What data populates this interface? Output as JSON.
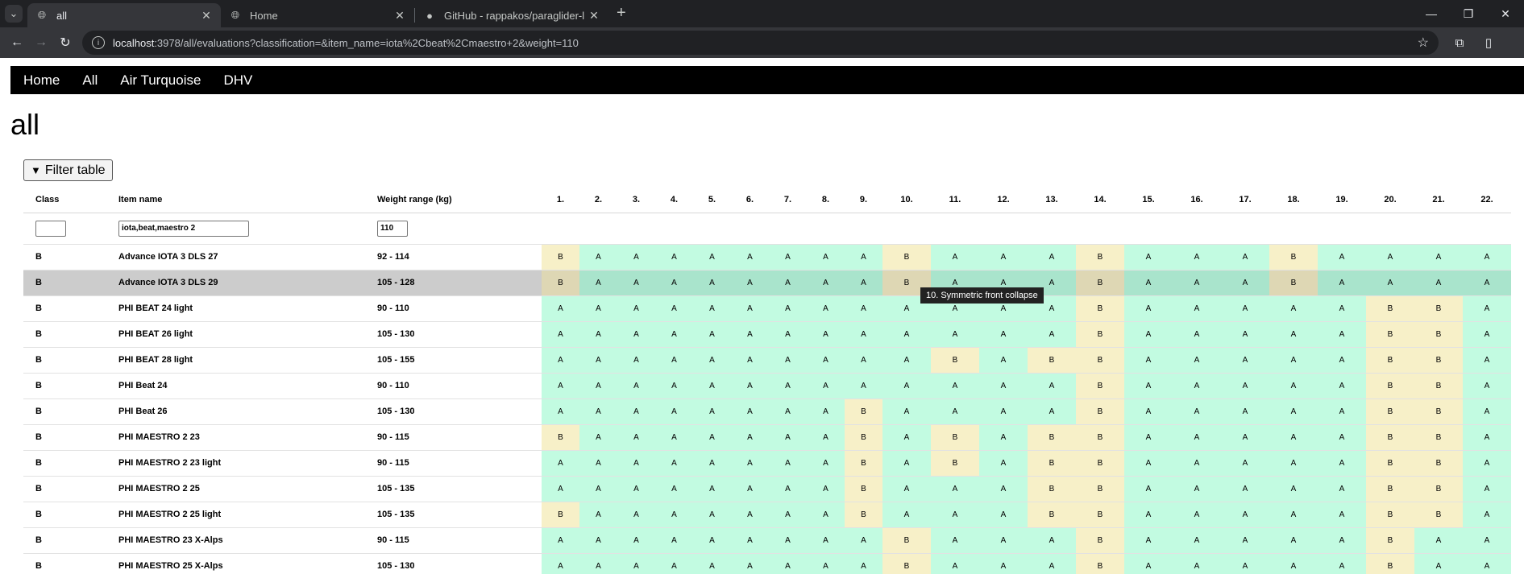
{
  "browser": {
    "tabs": [
      {
        "title": "all",
        "active": true
      },
      {
        "title": "Home",
        "active": false
      },
      {
        "title": "GitHub - rappakos/paraglider-l",
        "active": false
      }
    ],
    "url_host": "localhost",
    "url_rest": ":3978/all/evaluations?classification=&item_name=iota%2Cbeat%2Cmaestro+2&weight=110"
  },
  "nav": {
    "items": [
      "Home",
      "All",
      "Air Turquoise",
      "DHV"
    ]
  },
  "page_title": "all",
  "filter_button": "Filter table",
  "table": {
    "headers": {
      "class": "Class",
      "item_name": "Item name",
      "weight": "Weight range (kg)",
      "tests": [
        "1.",
        "2.",
        "3.",
        "4.",
        "5.",
        "6.",
        "7.",
        "8.",
        "9.",
        "10.",
        "11.",
        "12.",
        "13.",
        "14.",
        "15.",
        "16.",
        "17.",
        "18.",
        "19.",
        "20.",
        "21.",
        "22."
      ]
    },
    "filters": {
      "class": "",
      "item_name": "iota,beat,maestro 2",
      "weight": "110"
    },
    "rows": [
      {
        "class": "B",
        "name": "Advance IOTA 3 DLS 27",
        "weight": "92 - 114",
        "r": [
          "B",
          "A",
          "A",
          "A",
          "A",
          "A",
          "A",
          "A",
          "A",
          "B",
          "A",
          "A",
          "A",
          "B",
          "A",
          "A",
          "A",
          "B",
          "A",
          "A",
          "A",
          "A"
        ]
      },
      {
        "class": "B",
        "name": "Advance IOTA 3 DLS 29",
        "weight": "105 - 128",
        "r": [
          "B",
          "A",
          "A",
          "A",
          "A",
          "A",
          "A",
          "A",
          "A",
          "B",
          "A",
          "A",
          "A",
          "B",
          "A",
          "A",
          "A",
          "B",
          "A",
          "A",
          "A",
          "A"
        ],
        "hover": true
      },
      {
        "class": "B",
        "name": "PHI BEAT 24 light",
        "weight": "90 - 110",
        "r": [
          "A",
          "A",
          "A",
          "A",
          "A",
          "A",
          "A",
          "A",
          "A",
          "A",
          "A",
          "A",
          "A",
          "B",
          "A",
          "A",
          "A",
          "A",
          "A",
          "B",
          "B",
          "A"
        ]
      },
      {
        "class": "B",
        "name": "PHI BEAT 26 light",
        "weight": "105 - 130",
        "r": [
          "A",
          "A",
          "A",
          "A",
          "A",
          "A",
          "A",
          "A",
          "A",
          "A",
          "A",
          "A",
          "A",
          "B",
          "A",
          "A",
          "A",
          "A",
          "A",
          "B",
          "B",
          "A"
        ]
      },
      {
        "class": "B",
        "name": "PHI BEAT 28 light",
        "weight": "105 - 155",
        "r": [
          "A",
          "A",
          "A",
          "A",
          "A",
          "A",
          "A",
          "A",
          "A",
          "A",
          "B",
          "A",
          "B",
          "B",
          "A",
          "A",
          "A",
          "A",
          "A",
          "B",
          "B",
          "A"
        ]
      },
      {
        "class": "B",
        "name": "PHI Beat 24",
        "weight": "90 - 110",
        "r": [
          "A",
          "A",
          "A",
          "A",
          "A",
          "A",
          "A",
          "A",
          "A",
          "A",
          "A",
          "A",
          "A",
          "B",
          "A",
          "A",
          "A",
          "A",
          "A",
          "B",
          "B",
          "A"
        ]
      },
      {
        "class": "B",
        "name": "PHI Beat 26",
        "weight": "105 - 130",
        "r": [
          "A",
          "A",
          "A",
          "A",
          "A",
          "A",
          "A",
          "A",
          "B",
          "A",
          "A",
          "A",
          "A",
          "B",
          "A",
          "A",
          "A",
          "A",
          "A",
          "B",
          "B",
          "A"
        ]
      },
      {
        "class": "B",
        "name": "PHI MAESTRO 2 23",
        "weight": "90 - 115",
        "r": [
          "B",
          "A",
          "A",
          "A",
          "A",
          "A",
          "A",
          "A",
          "B",
          "A",
          "B",
          "A",
          "B",
          "B",
          "A",
          "A",
          "A",
          "A",
          "A",
          "B",
          "B",
          "A"
        ]
      },
      {
        "class": "B",
        "name": "PHI MAESTRO 2 23 light",
        "weight": "90 - 115",
        "r": [
          "A",
          "A",
          "A",
          "A",
          "A",
          "A",
          "A",
          "A",
          "B",
          "A",
          "B",
          "A",
          "B",
          "B",
          "A",
          "A",
          "A",
          "A",
          "A",
          "B",
          "B",
          "A"
        ]
      },
      {
        "class": "B",
        "name": "PHI MAESTRO 2 25",
        "weight": "105 - 135",
        "r": [
          "A",
          "A",
          "A",
          "A",
          "A",
          "A",
          "A",
          "A",
          "B",
          "A",
          "A",
          "A",
          "B",
          "B",
          "A",
          "A",
          "A",
          "A",
          "A",
          "B",
          "B",
          "A"
        ]
      },
      {
        "class": "B",
        "name": "PHI MAESTRO 2 25 light",
        "weight": "105 - 135",
        "r": [
          "B",
          "A",
          "A",
          "A",
          "A",
          "A",
          "A",
          "A",
          "B",
          "A",
          "A",
          "A",
          "B",
          "B",
          "A",
          "A",
          "A",
          "A",
          "A",
          "B",
          "B",
          "A"
        ]
      },
      {
        "class": "B",
        "name": "PHI MAESTRO 23 X-Alps",
        "weight": "90 - 115",
        "r": [
          "A",
          "A",
          "A",
          "A",
          "A",
          "A",
          "A",
          "A",
          "A",
          "B",
          "A",
          "A",
          "A",
          "B",
          "A",
          "A",
          "A",
          "A",
          "A",
          "B",
          "A",
          "A"
        ]
      },
      {
        "class": "B",
        "name": "PHI MAESTRO 25 X-Alps",
        "weight": "105 - 130",
        "r": [
          "A",
          "A",
          "A",
          "A",
          "A",
          "A",
          "A",
          "A",
          "A",
          "B",
          "A",
          "A",
          "A",
          "B",
          "A",
          "A",
          "A",
          "A",
          "A",
          "B",
          "A",
          "A"
        ]
      }
    ]
  },
  "tooltip": "10. Symmetric front collapse",
  "colors": {
    "grade_a": "#c2fbe1",
    "grade_b": "#f7f0c8",
    "hover_row": "#cccccc"
  }
}
